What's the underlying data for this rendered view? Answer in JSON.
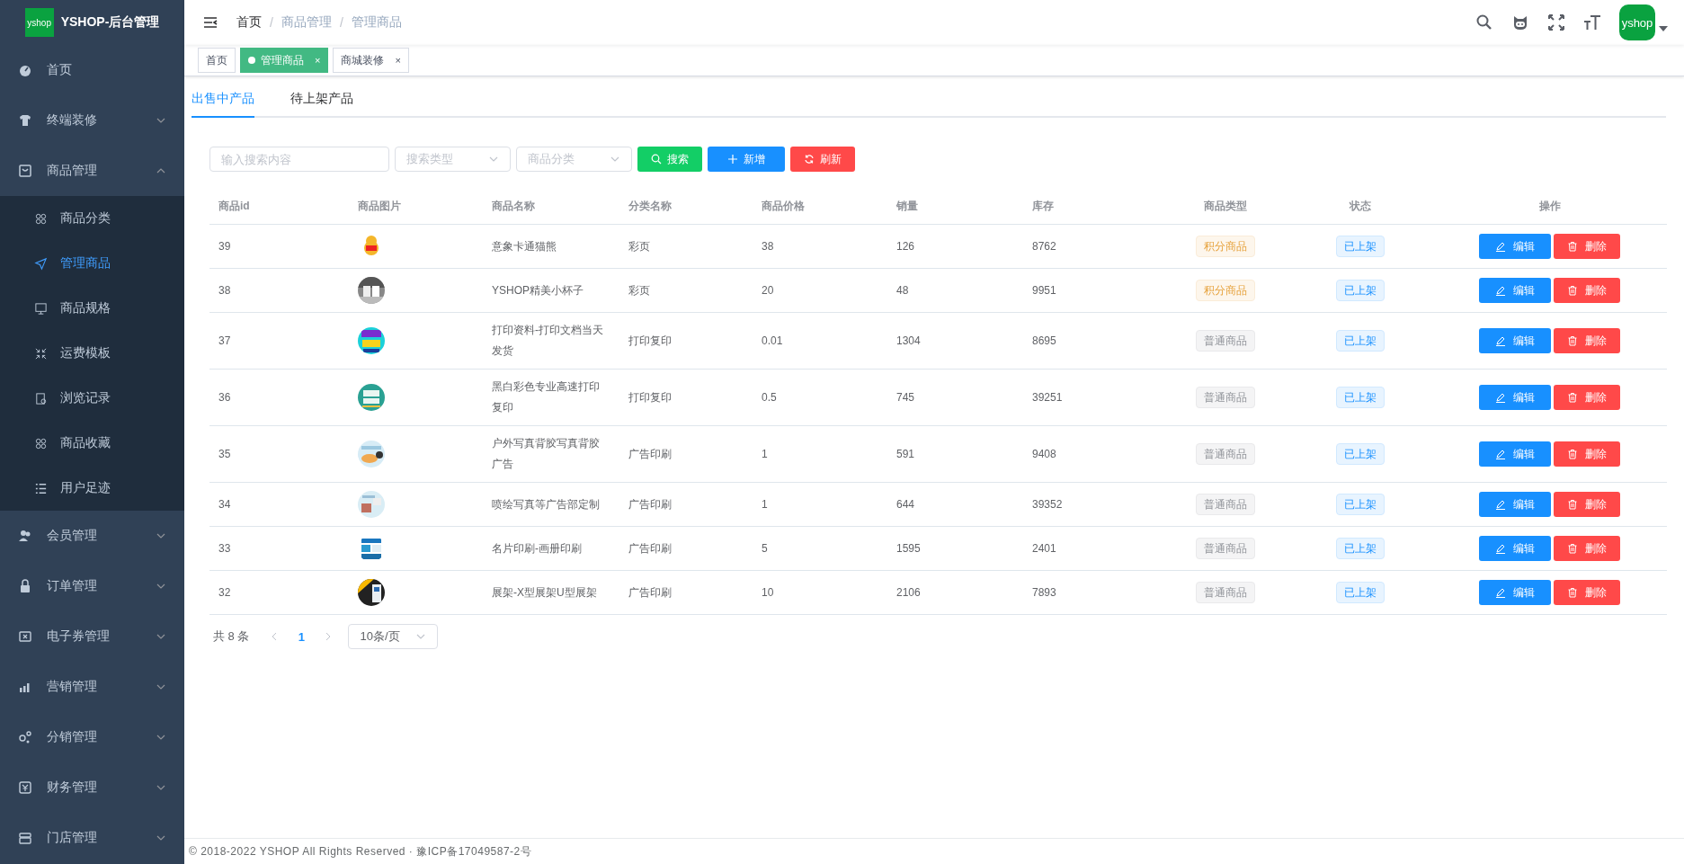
{
  "sidebar": {
    "logo_text": "yshop",
    "title": "YSHOP-后台管理",
    "items": [
      {
        "label": "首页",
        "kind": "link"
      },
      {
        "label": "终端装修",
        "kind": "group",
        "expanded": false
      },
      {
        "label": "商品管理",
        "kind": "group",
        "expanded": true,
        "children": [
          {
            "label": "商品分类",
            "selected": false
          },
          {
            "label": "管理商品",
            "selected": true
          },
          {
            "label": "商品规格",
            "selected": false
          },
          {
            "label": "运费模板",
            "selected": false
          },
          {
            "label": "浏览记录",
            "selected": false
          },
          {
            "label": "商品收藏",
            "selected": false
          },
          {
            "label": "用户足迹",
            "selected": false
          }
        ]
      },
      {
        "label": "会员管理",
        "kind": "group",
        "expanded": false
      },
      {
        "label": "订单管理",
        "kind": "group",
        "expanded": false
      },
      {
        "label": "电子券管理",
        "kind": "group",
        "expanded": false
      },
      {
        "label": "营销管理",
        "kind": "group",
        "expanded": false
      },
      {
        "label": "分销管理",
        "kind": "group",
        "expanded": false
      },
      {
        "label": "财务管理",
        "kind": "group",
        "expanded": false
      },
      {
        "label": "门店管理",
        "kind": "group",
        "expanded": false
      }
    ]
  },
  "breadcrumb": {
    "items": [
      "首页",
      "商品管理",
      "管理商品"
    ],
    "separator": "/"
  },
  "header": {
    "avatar_text": "yshop"
  },
  "tags": [
    {
      "label": "首页",
      "selected": false
    },
    {
      "label": "管理商品",
      "selected": true,
      "close": "×"
    },
    {
      "label": "商城装修",
      "selected": false,
      "close": "×"
    }
  ],
  "tabs": [
    {
      "label": "出售中产品",
      "selected": true
    },
    {
      "label": "待上架产品",
      "selected": false
    }
  ],
  "toolbar": {
    "search": {
      "placeholder": "输入搜索内容"
    },
    "search_type": {
      "placeholder": "搜索类型"
    },
    "category": {
      "placeholder": "商品分类"
    },
    "buttons": [
      {
        "label": "搜索",
        "kind": "search"
      },
      {
        "label": "新增",
        "kind": "add"
      },
      {
        "label": "刷新",
        "kind": "refresh"
      }
    ]
  },
  "table": {
    "columns": [
      "商品id",
      "商品图片",
      "商品名称",
      "分类名称",
      "商品价格",
      "销量",
      "库存",
      "商品类型",
      "状态",
      "操作"
    ],
    "rows": [
      {
        "id": "39",
        "name": "意象卡通猫熊",
        "category": "彩页",
        "price": "38",
        "sales": "126",
        "stock": "8762",
        "type": {
          "label": "积分商品",
          "kind": "points"
        },
        "status": "已上架",
        "actions": [
          "编辑",
          "删除"
        ]
      },
      {
        "id": "38",
        "name": "YSHOP精美小杯子",
        "category": "彩页",
        "price": "20",
        "sales": "48",
        "stock": "9951",
        "type": {
          "label": "积分商品",
          "kind": "points"
        },
        "status": "已上架",
        "actions": [
          "编辑",
          "删除"
        ]
      },
      {
        "id": "37",
        "name": "打印资料-打印文档当天发货",
        "category": "打印复印",
        "price": "0.01",
        "sales": "1304",
        "stock": "8695",
        "type": {
          "label": "普通商品",
          "kind": "normal"
        },
        "status": "已上架",
        "actions": [
          "编辑",
          "删除"
        ]
      },
      {
        "id": "36",
        "name": "黑白彩色专业高速打印复印",
        "category": "打印复印",
        "price": "0.5",
        "sales": "745",
        "stock": "39251",
        "type": {
          "label": "普通商品",
          "kind": "normal"
        },
        "status": "已上架",
        "actions": [
          "编辑",
          "删除"
        ]
      },
      {
        "id": "35",
        "name": "户外写真背胶写真背胶广告",
        "category": "广告印刷",
        "price": "1",
        "sales": "591",
        "stock": "9408",
        "type": {
          "label": "普通商品",
          "kind": "normal"
        },
        "status": "已上架",
        "actions": [
          "编辑",
          "删除"
        ]
      },
      {
        "id": "34",
        "name": "喷绘写真等广告部定制",
        "category": "广告印刷",
        "price": "1",
        "sales": "644",
        "stock": "39352",
        "type": {
          "label": "普通商品",
          "kind": "normal"
        },
        "status": "已上架",
        "actions": [
          "编辑",
          "删除"
        ]
      },
      {
        "id": "33",
        "name": "名片印刷-画册印刷",
        "category": "广告印刷",
        "price": "5",
        "sales": "1595",
        "stock": "2401",
        "type": {
          "label": "普通商品",
          "kind": "normal"
        },
        "status": "已上架",
        "actions": [
          "编辑",
          "删除"
        ]
      },
      {
        "id": "32",
        "name": "展架-X型展架U型展架",
        "category": "广告印刷",
        "price": "10",
        "sales": "2106",
        "stock": "7893",
        "type": {
          "label": "普通商品",
          "kind": "normal"
        },
        "status": "已上架",
        "actions": [
          "编辑",
          "删除"
        ]
      }
    ]
  },
  "pagination": {
    "total": "共 8 条",
    "pages": [
      {
        "label": "1",
        "selected": true
      }
    ],
    "page_size": "10条/页"
  },
  "footer": "© 2018-2022 YSHOP All Rights Reserved · 豫ICP备17049587-2号"
}
